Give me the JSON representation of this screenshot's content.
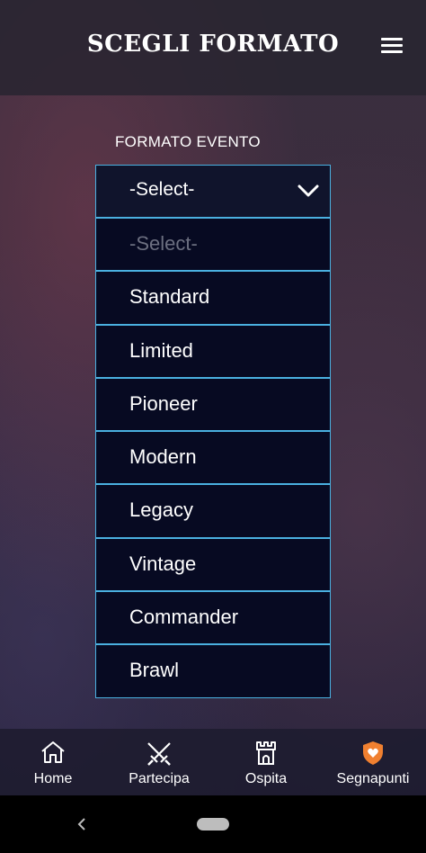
{
  "header": {
    "title": "SCEGLI FORMATO",
    "menu_icon": "hamburger-menu-icon"
  },
  "form": {
    "label": "FORMATO EVENTO",
    "select_value": "-Select-",
    "options": [
      "-Select-",
      "Standard",
      "Limited",
      "Pioneer",
      "Modern",
      "Legacy",
      "Vintage",
      "Commander",
      "Brawl"
    ]
  },
  "tabs": [
    {
      "label": "Home",
      "icon": "home-icon"
    },
    {
      "label": "Partecipa",
      "icon": "crossed-swords-icon"
    },
    {
      "label": "Ospita",
      "icon": "castle-tower-icon"
    },
    {
      "label": "Segnapunti",
      "icon": "heart-shield-icon"
    }
  ],
  "colors": {
    "accent_border": "#4ab0e0",
    "option_bg": "#070a22",
    "shield_orange": "#f08030"
  }
}
